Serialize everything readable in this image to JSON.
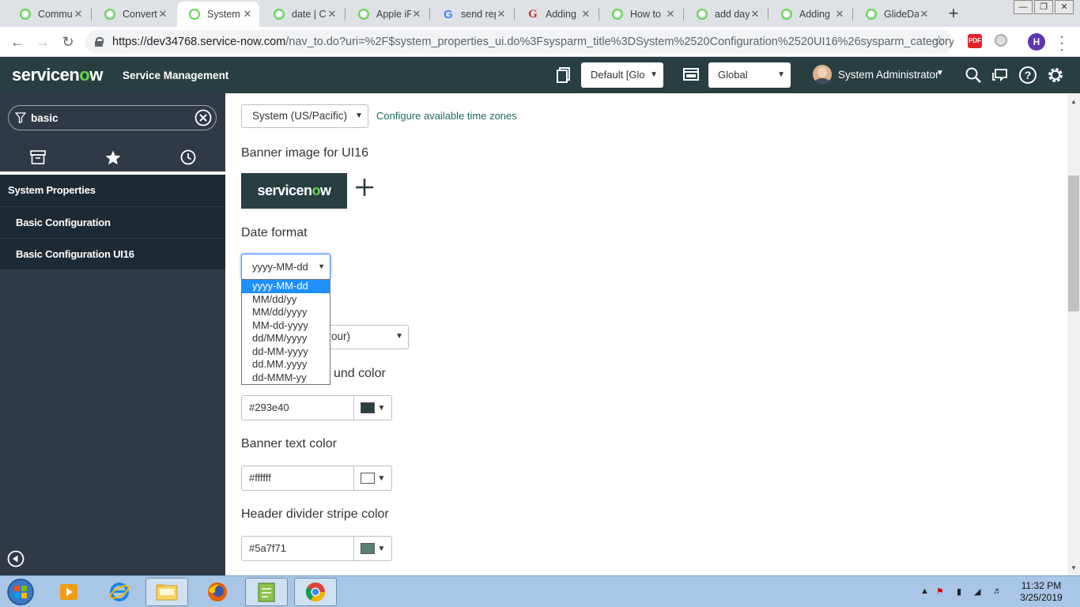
{
  "browser": {
    "tabs": [
      {
        "title": "Commu",
        "icon": "servicenow-icon",
        "active": false
      },
      {
        "title": "Convert",
        "icon": "servicenow-icon",
        "active": false
      },
      {
        "title": "System",
        "icon": "servicenow-icon",
        "active": true
      },
      {
        "title": "date | C",
        "icon": "servicenow-icon",
        "active": false
      },
      {
        "title": "Apple iP",
        "icon": "servicenow-icon",
        "active": false
      },
      {
        "title": "send rep",
        "icon": "google-icon",
        "active": false
      },
      {
        "title": "Adding",
        "icon": "g-icon",
        "active": false
      },
      {
        "title": "How to",
        "icon": "servicenow-icon",
        "active": false
      },
      {
        "title": "add day",
        "icon": "servicenow-icon",
        "active": false
      },
      {
        "title": "Adding",
        "icon": "servicenow-icon",
        "active": false
      },
      {
        "title": "GlideDa",
        "icon": "servicenow-icon",
        "active": false
      }
    ],
    "new_tab_label": "+",
    "url_host": "https://dev34768.service-now.com",
    "url_path": "/nav_to.do?uri=%2F$system_properties_ui.do%3Fsysparm_title%3DSystem%2520Configuration%2520UI16%26sysparm_category%...",
    "profile_initial": "H",
    "ext_label": "PDF"
  },
  "header": {
    "logo_pre": "servicen",
    "logo_o": "o",
    "logo_post": "w",
    "product": "Service Management",
    "update_set": "Default [Glo",
    "scope": "Global",
    "user_name": "System Administrator"
  },
  "nav": {
    "filter_value": "basic",
    "app_title": "System Properties",
    "modules": [
      "Basic Configuration",
      "Basic Configuration UI16"
    ]
  },
  "main": {
    "timezone_value": "System (US/Pacific)",
    "timezone_link": "Configure available time zones",
    "banner_label": "Banner image for UI16",
    "banner_logo_pre": "servicen",
    "banner_logo_o": "o",
    "banner_logo_post": "w",
    "date_format_label": "Date format",
    "date_format_value": "yyyy-MM-dd",
    "date_format_options": [
      "yyyy-MM-dd",
      "MM/dd/yy",
      "MM/dd/yyyy",
      "MM-dd-yyyy",
      "dd/MM/yyyy",
      "dd-MM-yyyy",
      "dd.MM.yyyy",
      "dd-MMM-yy"
    ],
    "hidden_select_partial": "our)",
    "hidden_label_partial": "und color",
    "bg_color_value": "#293e40",
    "banner_text_label": "Banner text color",
    "banner_text_value": "#ffffff",
    "divider_label": "Header divider stripe color",
    "divider_value": "#5a7f71"
  },
  "colors": {
    "header_bg": "#293e40",
    "accent_green": "#62d84e",
    "nav_bg": "#303a46",
    "swatch_bg": "#293e40",
    "swatch_text": "#ffffff",
    "swatch_divider": "#5a7f71"
  },
  "taskbar": {
    "time": "11:32 PM",
    "date": "3/25/2019"
  }
}
